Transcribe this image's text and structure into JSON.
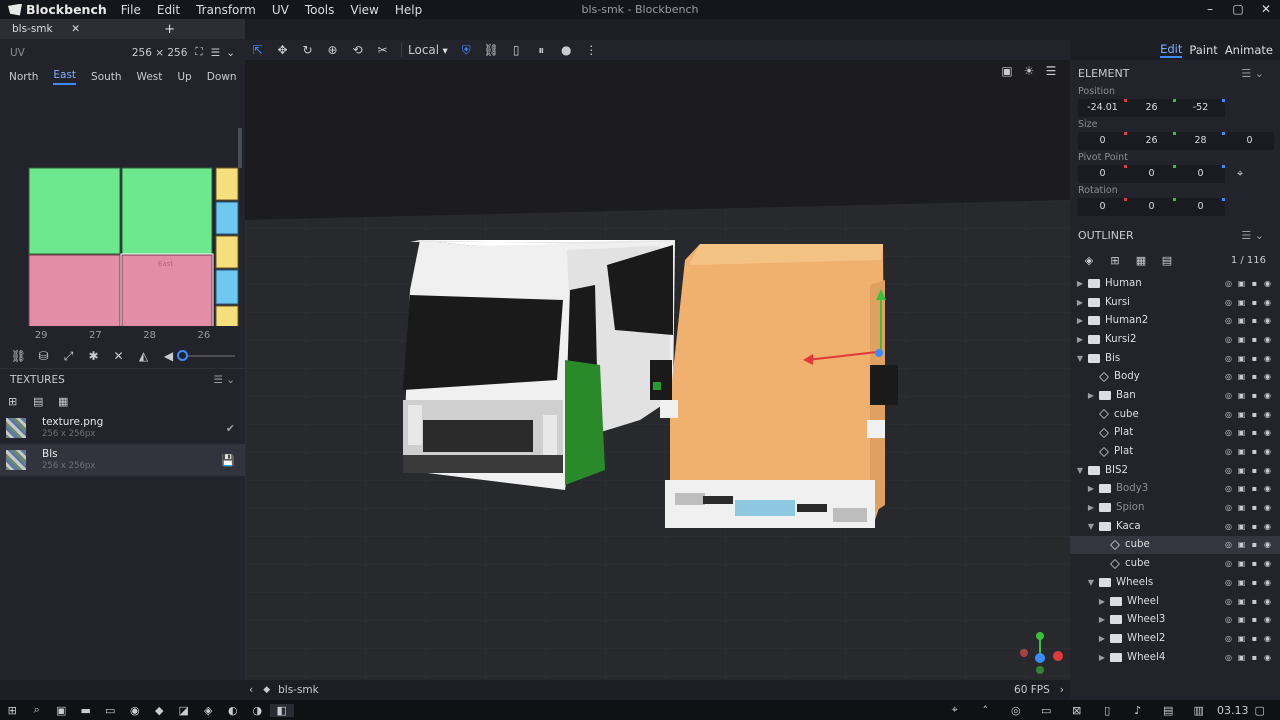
{
  "app": {
    "name": "Blockbench",
    "window_title": "bls-smk - Blockbench"
  },
  "menu": [
    "File",
    "Edit",
    "Transform",
    "UV",
    "Tools",
    "View",
    "Help"
  ],
  "tab": {
    "name": "bls-smk"
  },
  "uv": {
    "title": "UV",
    "resolution": "256 ⨯ 256",
    "faces": [
      "North",
      "East",
      "South",
      "West",
      "Up",
      "Down"
    ],
    "active_face": "East",
    "numbers": [
      "29",
      "27",
      "28",
      "26"
    ],
    "face_label": "East"
  },
  "textures": {
    "title": "TEXTURES",
    "items": [
      {
        "name": "texture.png",
        "size": "256 x 256px",
        "status": "✔"
      },
      {
        "name": "Bls",
        "size": "256 x 256px",
        "status": "💾"
      }
    ]
  },
  "toolbar": {
    "space": "Local"
  },
  "modes": [
    "Edit",
    "Paint",
    "Animate"
  ],
  "active_mode": "Edit",
  "element": {
    "title": "ELEMENT",
    "position_label": "Position",
    "position": [
      "-24.01",
      "26",
      "-52"
    ],
    "size_label": "Size",
    "size": [
      "0",
      "26",
      "28",
      "0"
    ],
    "pivot_label": "Pivot Point",
    "pivot": [
      "0",
      "0",
      "0"
    ],
    "rotation_label": "Rotation",
    "rotation": [
      "0",
      "0",
      "0"
    ]
  },
  "outliner": {
    "title": "OUTLINER",
    "count": "1 / 116",
    "nodes": [
      {
        "label": "Human",
        "type": "group",
        "depth": 0,
        "open": false
      },
      {
        "label": "Kursi",
        "type": "group",
        "depth": 0,
        "open": false
      },
      {
        "label": "Human2",
        "type": "group",
        "depth": 0,
        "open": false
      },
      {
        "label": "Kursi2",
        "type": "group",
        "depth": 0,
        "open": false
      },
      {
        "label": "Bis",
        "type": "group",
        "depth": 0,
        "open": true
      },
      {
        "label": "Body",
        "type": "cube",
        "depth": 1
      },
      {
        "label": "Ban",
        "type": "group",
        "depth": 1,
        "open": false
      },
      {
        "label": "cube",
        "type": "cube",
        "depth": 1
      },
      {
        "label": "Plat",
        "type": "cube",
        "depth": 1
      },
      {
        "label": "Plat",
        "type": "cube",
        "depth": 1
      },
      {
        "label": "BIS2",
        "type": "group",
        "depth": 0,
        "open": true
      },
      {
        "label": "Body3",
        "type": "group",
        "depth": 1,
        "open": false,
        "dim": true
      },
      {
        "label": "Spion",
        "type": "group",
        "depth": 1,
        "open": false,
        "dim": true
      },
      {
        "label": "Kaca",
        "type": "group",
        "depth": 1,
        "open": true
      },
      {
        "label": "cube",
        "type": "cube",
        "depth": 2,
        "selected": true
      },
      {
        "label": "cube",
        "type": "cube",
        "depth": 2
      },
      {
        "label": "Wheels",
        "type": "group",
        "depth": 1,
        "open": true
      },
      {
        "label": "Wheel",
        "type": "group",
        "depth": 2,
        "open": false
      },
      {
        "label": "Wheel3",
        "type": "group",
        "depth": 2,
        "open": false
      },
      {
        "label": "Wheel2",
        "type": "group",
        "depth": 2,
        "open": false
      },
      {
        "label": "Wheel4",
        "type": "group",
        "depth": 2,
        "open": false
      }
    ]
  },
  "status": {
    "project": "bls-smk",
    "fps": "60 FPS"
  },
  "taskbar": {
    "time": "03.13"
  },
  "colors": {
    "accent": "#3c8cff",
    "bg": "#1d1e24",
    "panel": "#23242b"
  }
}
